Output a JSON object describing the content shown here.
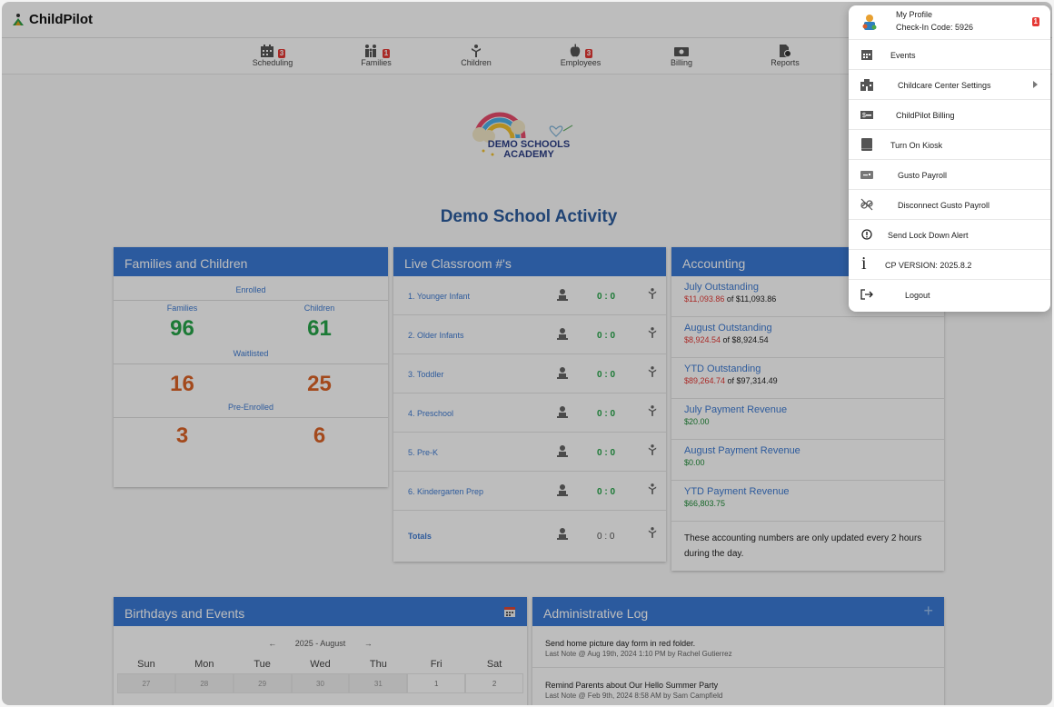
{
  "app": {
    "brand": "ChildPilot"
  },
  "nav": [
    {
      "label": "Scheduling",
      "badge": "3"
    },
    {
      "label": "Families",
      "badge": "1"
    },
    {
      "label": "Children",
      "badge": ""
    },
    {
      "label": "Employees",
      "badge": "3"
    },
    {
      "label": "Billing",
      "badge": ""
    },
    {
      "label": "Reports",
      "badge": ""
    }
  ],
  "school": {
    "logo_line1": "DEMO SCHOOLS",
    "logo_line2": "ACADEMY",
    "activity_title": "Demo School Activity"
  },
  "families_children": {
    "title": "Families and Children",
    "enrolled_label": "Enrolled",
    "families_label": "Families",
    "children_label": "Children",
    "enrolled_families": "96",
    "enrolled_children": "61",
    "waitlisted_label": "Waitlisted",
    "waitlisted_families": "16",
    "waitlisted_children": "25",
    "preenrolled_label": "Pre-Enrolled",
    "preenrolled_families": "3",
    "preenrolled_children": "6"
  },
  "classrooms": {
    "title": "Live Classroom #'s",
    "rows": [
      {
        "name": "1. Younger Infant",
        "ratio": "0 : 0"
      },
      {
        "name": "2. Older Infants",
        "ratio": "0 : 0"
      },
      {
        "name": "3. Toddler",
        "ratio": "0 : 0"
      },
      {
        "name": "4. Preschool",
        "ratio": "0 : 0"
      },
      {
        "name": "5. Pre-K",
        "ratio": "0 : 0"
      },
      {
        "name": "6. Kindergarten Prep",
        "ratio": "0 : 0"
      }
    ],
    "totals_label": "Totals",
    "totals_ratio": "0 : 0"
  },
  "accounting": {
    "title": "Accounting",
    "rows": [
      {
        "title": "July Outstanding",
        "amount": "$11,093.86",
        "of": " of $11,093.86",
        "color": "#e53935"
      },
      {
        "title": "August Outstanding",
        "amount": "$8,924.54",
        "of": " of $8,924.54",
        "color": "#e53935"
      },
      {
        "title": "YTD Outstanding",
        "amount": "$89,264.74",
        "of": " of $97,314.49",
        "color": "#e53935"
      },
      {
        "title": "July Payment Revenue",
        "amount": "$20.00",
        "of": "",
        "color": "#1e8b37"
      },
      {
        "title": "August Payment Revenue",
        "amount": "$0.00",
        "of": "",
        "color": "#1e8b37"
      },
      {
        "title": "YTD Payment Revenue",
        "amount": "$66,803.75",
        "of": "",
        "color": "#1e8b37"
      }
    ],
    "note": "These accounting numbers are only updated every 2 hours during the day."
  },
  "birthdays": {
    "title": "Birthdays and Events",
    "prev": "←",
    "month": "2025 - August",
    "next": "→",
    "weekdays": [
      "Sun",
      "Mon",
      "Tue",
      "Wed",
      "Thu",
      "Fri",
      "Sat"
    ],
    "days": [
      "27",
      "28",
      "29",
      "30",
      "31",
      "1",
      "2"
    ]
  },
  "admin_log": {
    "title": "Administrative Log",
    "add": "+",
    "entries": [
      {
        "note": "Send home picture day form in red folder.",
        "meta": "Last Note @ Aug 19th, 2024 1:10 PM by Rachel Gutierrez"
      },
      {
        "note": "Remind Parents about Our Hello Summer Party",
        "meta": "Last Note @ Feb 9th, 2024 8:58 AM by Sam Campfield"
      }
    ]
  },
  "menu": {
    "profile": "My Profile",
    "checkin": "Check-In Code: 5926",
    "badge": "1",
    "items": [
      {
        "label": "Events",
        "icon": "calendar-icon"
      },
      {
        "label": "Childcare Center Settings",
        "icon": "building-icon"
      },
      {
        "label": "ChildPilot Billing",
        "icon": "dollar-card-icon"
      },
      {
        "label": "Turn On Kiosk",
        "icon": "tablet-icon"
      },
      {
        "label": "Gusto Payroll",
        "icon": "payroll-card-icon"
      },
      {
        "label": "Disconnect Gusto Payroll",
        "icon": "unlink-icon"
      },
      {
        "label": "Send Lock Down Alert",
        "icon": "alert-circle-icon"
      },
      {
        "label": "CP VERSION: 2025.8.2",
        "icon": "info-icon"
      },
      {
        "label": "Logout",
        "icon": "logout-icon"
      }
    ]
  }
}
